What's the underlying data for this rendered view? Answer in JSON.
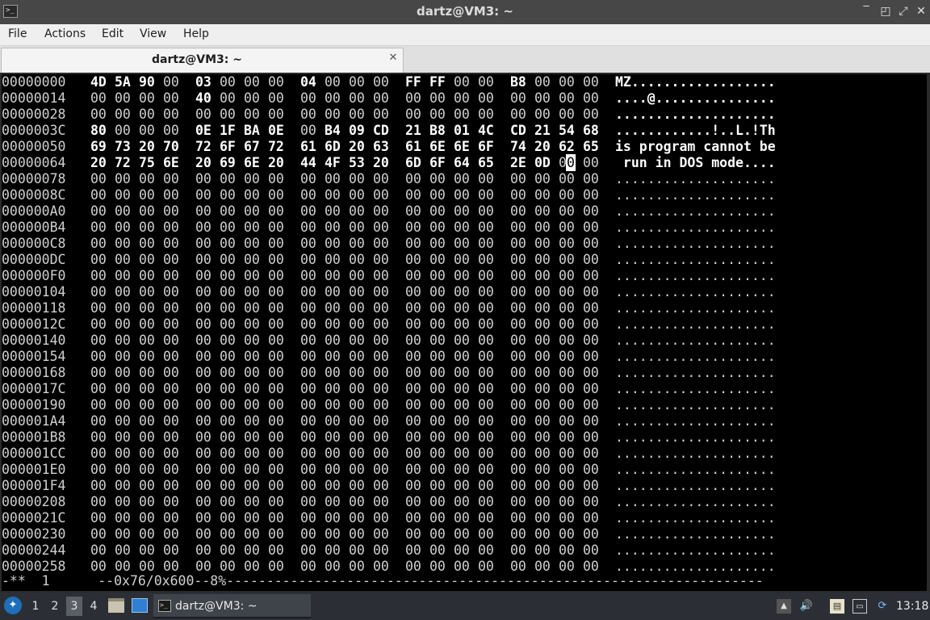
{
  "window": {
    "title": "dartz@VM3: ~",
    "app_icon": ">_",
    "buttons": {
      "minimize": "‾",
      "restore": "◰",
      "maximize": "⤢",
      "close": "✕"
    }
  },
  "menu": [
    "File",
    "Actions",
    "Edit",
    "View",
    "Help"
  ],
  "tab": {
    "label": "dartz@VM3: ~",
    "close": "✕"
  },
  "hexdump": {
    "rows": [
      {
        "addr": "00000000",
        "bytes": [
          "4D",
          "5A",
          "90",
          "00",
          "03",
          "00",
          "00",
          "00",
          "04",
          "00",
          "00",
          "00",
          "FF",
          "FF",
          "00",
          "00",
          "B8",
          "00",
          "00",
          "00"
        ],
        "ascii": "MZ.................."
      },
      {
        "addr": "00000014",
        "bytes": [
          "00",
          "00",
          "00",
          "00",
          "40",
          "00",
          "00",
          "00",
          "00",
          "00",
          "00",
          "00",
          "00",
          "00",
          "00",
          "00",
          "00",
          "00",
          "00",
          "00"
        ],
        "ascii": "....@..............."
      },
      {
        "addr": "00000028",
        "bytes": [
          "00",
          "00",
          "00",
          "00",
          "00",
          "00",
          "00",
          "00",
          "00",
          "00",
          "00",
          "00",
          "00",
          "00",
          "00",
          "00",
          "00",
          "00",
          "00",
          "00"
        ],
        "ascii": "...................."
      },
      {
        "addr": "0000003C",
        "bytes": [
          "80",
          "00",
          "00",
          "00",
          "0E",
          "1F",
          "BA",
          "0E",
          "00",
          "B4",
          "09",
          "CD",
          "21",
          "B8",
          "01",
          "4C",
          "CD",
          "21",
          "54",
          "68"
        ],
        "ascii": "............!..L.!Th"
      },
      {
        "addr": "00000050",
        "bytes": [
          "69",
          "73",
          "20",
          "70",
          "72",
          "6F",
          "67",
          "72",
          "61",
          "6D",
          "20",
          "63",
          "61",
          "6E",
          "6E",
          "6F",
          "74",
          "20",
          "62",
          "65"
        ],
        "ascii": "is program cannot be"
      },
      {
        "addr": "00000064",
        "bytes": [
          "20",
          "72",
          "75",
          "6E",
          "20",
          "69",
          "6E",
          "20",
          "44",
          "4F",
          "53",
          "20",
          "6D",
          "6F",
          "64",
          "65",
          "2E",
          "0D",
          "00",
          "00"
        ],
        "ascii": " run in DOS mode...."
      },
      {
        "addr": "00000078",
        "zero": true,
        "ascii": "...................."
      },
      {
        "addr": "0000008C",
        "zero": true,
        "ascii": "...................."
      },
      {
        "addr": "000000A0",
        "zero": true,
        "ascii": "...................."
      },
      {
        "addr": "000000B4",
        "zero": true,
        "ascii": "...................."
      },
      {
        "addr": "000000C8",
        "zero": true,
        "ascii": "...................."
      },
      {
        "addr": "000000DC",
        "zero": true,
        "ascii": "...................."
      },
      {
        "addr": "000000F0",
        "zero": true,
        "ascii": "...................."
      },
      {
        "addr": "00000104",
        "zero": true,
        "ascii": "...................."
      },
      {
        "addr": "00000118",
        "zero": true,
        "ascii": "...................."
      },
      {
        "addr": "0000012C",
        "zero": true,
        "ascii": "...................."
      },
      {
        "addr": "00000140",
        "zero": true,
        "ascii": "...................."
      },
      {
        "addr": "00000154",
        "zero": true,
        "ascii": "...................."
      },
      {
        "addr": "00000168",
        "zero": true,
        "ascii": "...................."
      },
      {
        "addr": "0000017C",
        "zero": true,
        "ascii": "...................."
      },
      {
        "addr": "00000190",
        "zero": true,
        "ascii": "...................."
      },
      {
        "addr": "000001A4",
        "zero": true,
        "ascii": "...................."
      },
      {
        "addr": "000001B8",
        "zero": true,
        "ascii": "...................."
      },
      {
        "addr": "000001CC",
        "zero": true,
        "ascii": "...................."
      },
      {
        "addr": "000001E0",
        "zero": true,
        "ascii": "...................."
      },
      {
        "addr": "000001F4",
        "zero": true,
        "ascii": "...................."
      },
      {
        "addr": "00000208",
        "zero": true,
        "ascii": "...................."
      },
      {
        "addr": "0000021C",
        "zero": true,
        "ascii": "...................."
      },
      {
        "addr": "00000230",
        "zero": true,
        "ascii": "...................."
      },
      {
        "addr": "00000244",
        "zero": true,
        "ascii": "...................."
      },
      {
        "addr": "00000258",
        "zero": true,
        "ascii": "...................."
      }
    ],
    "cursor": {
      "row": 5,
      "byte": 18
    },
    "status_line": "-**  1      --0x76/0x600--8%-------------------------------------------------------------------"
  },
  "taskbar": {
    "workspaces": [
      "1",
      "2",
      "3",
      "4"
    ],
    "active_workspace": "3",
    "task_label": "dartz@VM3: ~",
    "clock": "13:18",
    "icons": [
      "start-menu-icon",
      "file-manager-icon",
      "show-desktop-icon",
      "terminal-icon",
      "tray-up-icon",
      "volume-icon",
      "clipboard-icon",
      "network-icon",
      "update-icon"
    ]
  }
}
